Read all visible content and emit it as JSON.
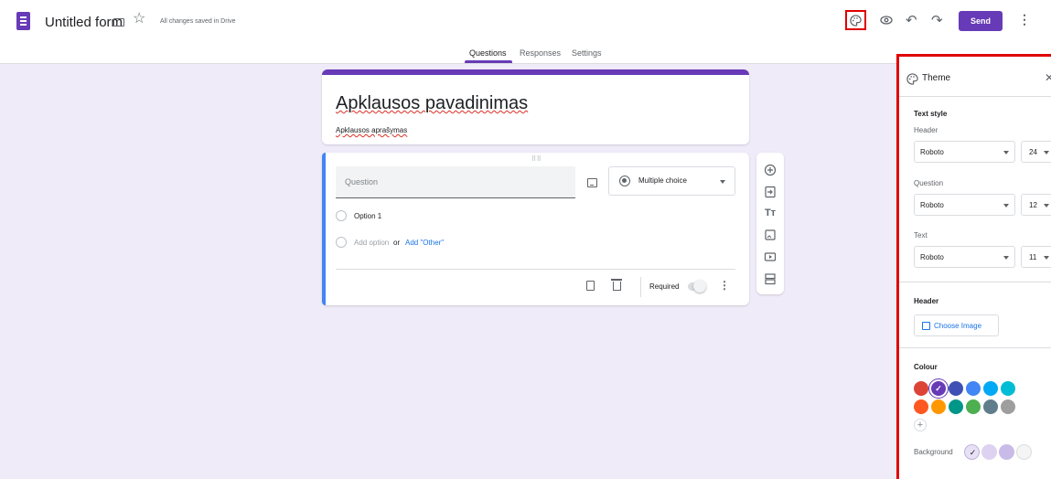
{
  "header": {
    "form_title": "Untitled form",
    "saved_status": "All changes saved in Drive",
    "send_label": "Send"
  },
  "tabs": [
    {
      "label": "Questions",
      "active": true
    },
    {
      "label": "Responses",
      "active": false
    },
    {
      "label": "Settings",
      "active": false
    }
  ],
  "form": {
    "title": "Apklausos pavadinimas",
    "description": "Apklausos aprašymas"
  },
  "question": {
    "placeholder": "Question",
    "type": "Multiple choice",
    "options": [
      "Option 1"
    ],
    "add_option": "Add option",
    "or_text": "or",
    "add_other": "Add \"Other\"",
    "required_label": "Required",
    "required": false
  },
  "toolbar": {
    "icons": [
      "add-question-icon",
      "import-questions-icon",
      "add-title-icon",
      "add-image-icon",
      "add-video-icon",
      "add-section-icon"
    ],
    "title_glyph": "Tт"
  },
  "theme_panel": {
    "title": "Theme",
    "text_style_heading": "Text style",
    "header_label": "Header",
    "header_font": "Roboto",
    "header_size": "24",
    "question_label": "Question",
    "question_font": "Roboto",
    "question_size": "12",
    "text_label": "Text",
    "text_font": "Roboto",
    "text_size": "11",
    "header_section_heading": "Header",
    "choose_image_label": "Choose Image",
    "colour_heading": "Colour",
    "colours": [
      "#db4437",
      "#673ab7",
      "#3f51b5",
      "#4285f4",
      "#03a9f4",
      "#00bcd4",
      "#ff5722",
      "#ff9800",
      "#009688",
      "#4caf50",
      "#607d8b",
      "#9e9e9e"
    ],
    "selected_colour": "#673ab7",
    "background_label": "Background",
    "backgrounds": [
      "#e8e0f5",
      "#ddd3f0",
      "#c9bbe8",
      "#f5f5f5"
    ],
    "selected_background": "#e8e0f5"
  },
  "colors": {
    "accent": "#673ab7",
    "highlight_box": "#e00000",
    "link": "#1a73e8",
    "question_accent": "#4285f4"
  }
}
